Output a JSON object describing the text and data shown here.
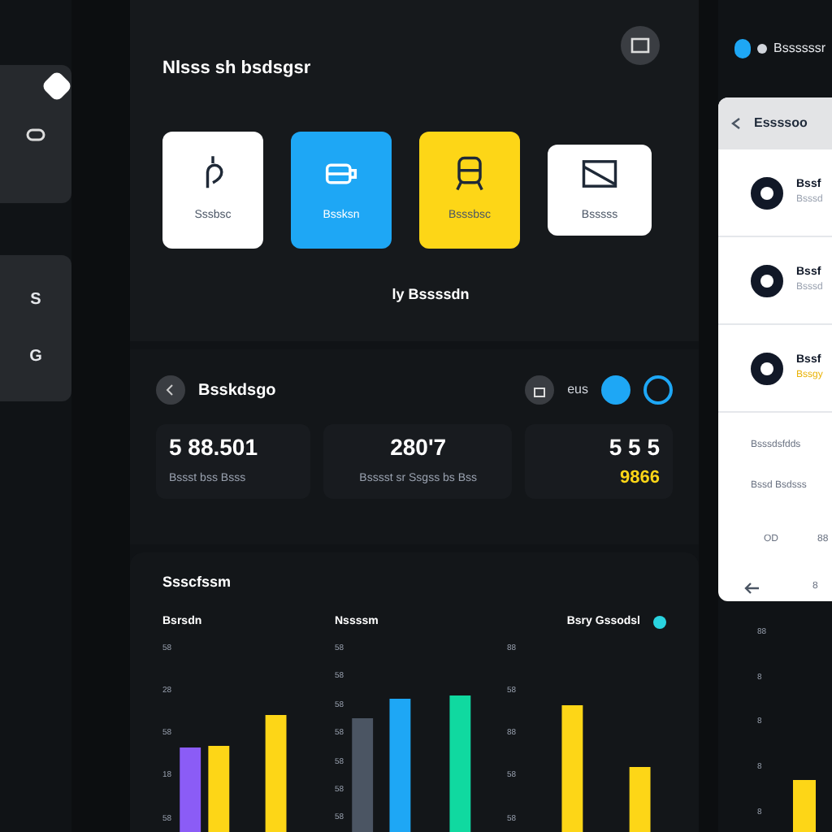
{
  "sidebar": {
    "cards": [
      {
        "kind": "badge"
      },
      {
        "kind": "letters",
        "texts": [
          "S",
          "G"
        ]
      }
    ]
  },
  "tiles_section": {
    "title": "Nlsss sh bsdsgsr",
    "tiles": [
      {
        "label": "Sssbsc",
        "color": "#ffffff",
        "kind": "hook"
      },
      {
        "label": "Bssksn",
        "color": "#1ea7f5",
        "kind": "cup"
      },
      {
        "label": "Bsssbsc",
        "color": "#fdd617",
        "kind": "seat"
      },
      {
        "label": "Bsssss",
        "color": "#ffffff",
        "kind": "frame"
      }
    ],
    "footer": "ly Bssssdn"
  },
  "stats": {
    "title": "Bsskdsgo",
    "header_text": "eus",
    "cards": [
      {
        "value": "5 88.501",
        "caption": "Bssst bss Bsss",
        "kind": "plain"
      },
      {
        "value": "280'7",
        "caption": "Bsssst sr Ssgss bs Bss",
        "kind": "plain"
      },
      {
        "value": "5 5 5",
        "caption": "9866",
        "kind": "accent"
      }
    ]
  },
  "chart": {
    "title": "Ssscfssm",
    "groups": [
      {
        "label": "Bsrsdn",
        "ticks": [
          "58",
          "28",
          "58",
          "18",
          "58"
        ]
      },
      {
        "label": "Nssssm",
        "ticks": [
          "58",
          "58",
          "58",
          "58",
          "58",
          "58",
          "58"
        ]
      },
      {
        "label": "Bsry Gssodsl",
        "ticks": [
          "88",
          "58",
          "88",
          "58",
          "58"
        ],
        "color": "#2ad4e0"
      }
    ]
  },
  "right_panel": {
    "header": "Bssssssr",
    "card": {
      "title": "Essssoo",
      "items": [
        {
          "title": "Bssf",
          "subtitle": "Bsssd",
          "accent": false
        },
        {
          "title": "Bssf",
          "subtitle": "Bsssd",
          "accent": false
        },
        {
          "title": "Bssf",
          "subtitle": "Bssgy",
          "accent": true
        }
      ],
      "lines": [
        "Bsssdsfdds",
        "Bssd Bsdsss"
      ],
      "values": [
        "OD",
        "88"
      ],
      "footer": "8"
    },
    "ticks": [
      "88",
      "8",
      "8",
      "8",
      "8"
    ]
  }
}
